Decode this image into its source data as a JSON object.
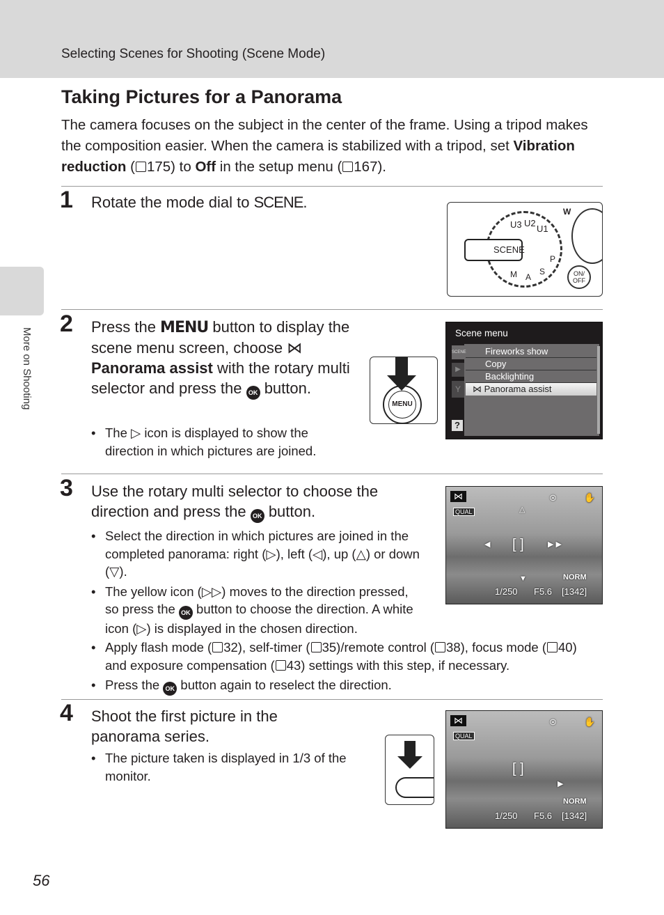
{
  "header": {
    "section": "Selecting Scenes for Shooting (Scene Mode)"
  },
  "side": {
    "tab": "More on Shooting"
  },
  "page_number": "56",
  "title": "Taking Pictures for a Panorama",
  "intro": [
    {
      "t": "The camera focuses on the subject in the center of the frame. Using a tripod makes the composition easier. When the camera is stabilized with a tripod, set "
    },
    {
      "b": "Vibration reduction"
    },
    {
      "t": " ("
    },
    {
      "i": "ref"
    },
    {
      "t": "175) to "
    },
    {
      "b": "Off"
    },
    {
      "t": " in the setup menu ("
    },
    {
      "i": "ref"
    },
    {
      "t": "167)."
    }
  ],
  "steps": [
    {
      "number": "1",
      "text": [
        {
          "t": "Rotate the mode dial to "
        },
        {
          "i": "scene",
          "v": "SCENE"
        },
        {
          "t": "."
        }
      ],
      "bullets": []
    },
    {
      "number": "2",
      "text": [
        {
          "t": "Press the "
        },
        {
          "i": "menu",
          "v": "MENU"
        },
        {
          "t": " button to display the scene menu screen, choose "
        },
        {
          "i": "pano",
          "v": "⋈"
        },
        {
          "b": " Panorama assist"
        },
        {
          "t": " with the rotary multi selector and press the "
        },
        {
          "i": "ok",
          "v": "OK"
        },
        {
          "t": " button."
        }
      ],
      "bullets": [
        [
          {
            "t": "The "
          },
          {
            "i": "tri",
            "v": "▷"
          },
          {
            "t": " icon is displayed to show the direction in which pictures are joined."
          }
        ]
      ]
    },
    {
      "number": "3",
      "text": [
        {
          "t": "Use the rotary multi selector to choose the direction and press the "
        },
        {
          "i": "ok",
          "v": "OK"
        },
        {
          "t": " button."
        }
      ],
      "bullets": [
        [
          {
            "t": "Select the direction in which pictures are joined in the completed panorama: right ("
          },
          {
            "i": "tri",
            "v": "▷"
          },
          {
            "t": "), left ("
          },
          {
            "i": "tri",
            "v": "◁"
          },
          {
            "t": "), up ("
          },
          {
            "i": "tri",
            "v": "△"
          },
          {
            "t": ") or down ("
          },
          {
            "i": "tri",
            "v": "▽"
          },
          {
            "t": ")."
          }
        ],
        [
          {
            "t": "The yellow icon ("
          },
          {
            "i": "tri",
            "v": "▷▷"
          },
          {
            "t": ") moves to the direction pressed, so press the "
          },
          {
            "i": "ok",
            "v": "OK"
          },
          {
            "t": " button to choose the direction. A white icon ("
          },
          {
            "i": "tri",
            "v": "▷"
          },
          {
            "t": ") is displayed in the chosen direction."
          }
        ],
        [
          {
            "t": "Apply flash mode ("
          },
          {
            "i": "ref"
          },
          {
            "t": "32), self-timer ("
          },
          {
            "i": "ref"
          },
          {
            "t": "35)/remote control ("
          },
          {
            "i": "ref"
          },
          {
            "t": "38), focus mode ("
          },
          {
            "i": "ref"
          },
          {
            "t": "40) and exposure compensation ("
          },
          {
            "i": "ref"
          },
          {
            "t": "43) settings with this step, if necessary."
          }
        ],
        [
          {
            "t": "Press the "
          },
          {
            "i": "ok",
            "v": "OK"
          },
          {
            "t": " button again to reselect the direction."
          }
        ]
      ]
    },
    {
      "number": "4",
      "text": [
        {
          "t": "Shoot the first picture in the panorama series."
        }
      ],
      "bullets": [
        [
          {
            "t": "The picture taken is displayed in 1/3 of the monitor."
          }
        ]
      ]
    }
  ],
  "dial": {
    "labels": [
      "SCENE",
      "U3",
      "U2",
      "U1",
      "P",
      "S",
      "A",
      "M",
      "W",
      "ON/ OFF"
    ]
  },
  "menu_button": {
    "label": "MENU"
  },
  "scene_menu": {
    "title": "Scene menu",
    "tab_label": "SCENE",
    "help": "?",
    "items": [
      "Fireworks show",
      "Copy",
      "Backlighting",
      "Panorama assist"
    ],
    "selected": "Panorama assist"
  },
  "screen": {
    "qual": "QUAL",
    "norm": "NORM",
    "shutter": "1/250",
    "aperture": "F5.6",
    "remaining": "[1342]"
  }
}
